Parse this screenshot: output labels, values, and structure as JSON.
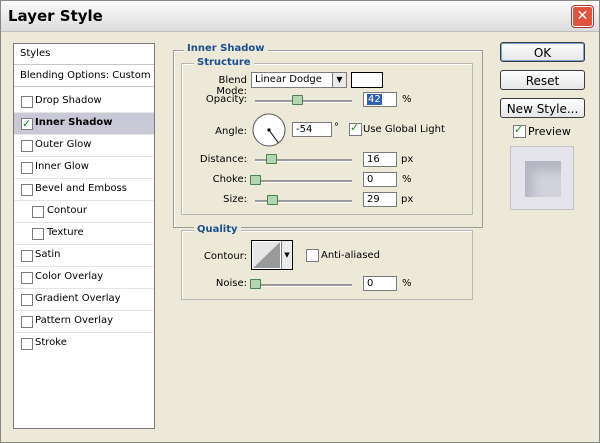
{
  "window": {
    "title": "Layer Style",
    "close_icon": "close-icon"
  },
  "sidebar": {
    "items": [
      {
        "label": "Styles",
        "type": "header"
      },
      {
        "label": "Blending Options: Custom",
        "type": "header"
      },
      {
        "label": "Drop Shadow",
        "checked": false
      },
      {
        "label": "Inner Shadow",
        "checked": true,
        "selected": true
      },
      {
        "label": "Outer Glow",
        "checked": false
      },
      {
        "label": "Inner Glow",
        "checked": false
      },
      {
        "label": "Bevel and Emboss",
        "checked": false
      },
      {
        "label": "Contour",
        "checked": false,
        "indent": true
      },
      {
        "label": "Texture",
        "checked": false,
        "indent": true
      },
      {
        "label": "Satin",
        "checked": false
      },
      {
        "label": "Color Overlay",
        "checked": false
      },
      {
        "label": "Gradient Overlay",
        "checked": false
      },
      {
        "label": "Pattern Overlay",
        "checked": false
      },
      {
        "label": "Stroke",
        "checked": false
      }
    ]
  },
  "inner_shadow": {
    "title": "Inner Shadow",
    "structure": {
      "title": "Structure",
      "blend_mode_label": "Blend Mode:",
      "blend_mode_value": "Linear Dodge",
      "opacity_label": "Opacity:",
      "opacity_value": "42",
      "opacity_unit": "%",
      "angle_label": "Angle:",
      "angle_value": "-54",
      "angle_unit": "°",
      "use_global_light_label": "Use Global Light",
      "use_global_light_checked": true,
      "distance_label": "Distance:",
      "distance_value": "16",
      "distance_unit": "px",
      "choke_label": "Choke:",
      "choke_value": "0",
      "choke_unit": "%",
      "size_label": "Size:",
      "size_value": "29",
      "size_unit": "px"
    },
    "quality": {
      "title": "Quality",
      "contour_label": "Contour:",
      "anti_aliased_label": "Anti-aliased",
      "anti_aliased_checked": false,
      "noise_label": "Noise:",
      "noise_value": "0",
      "noise_unit": "%"
    }
  },
  "buttons": {
    "ok": "OK",
    "reset": "Reset",
    "new_style": "New Style..."
  },
  "preview": {
    "label": "Preview",
    "checked": true
  },
  "colors": {
    "highlight": "#2f5fb0",
    "legend": "#1d4e8c",
    "selected_row": "#c8c8d6"
  }
}
